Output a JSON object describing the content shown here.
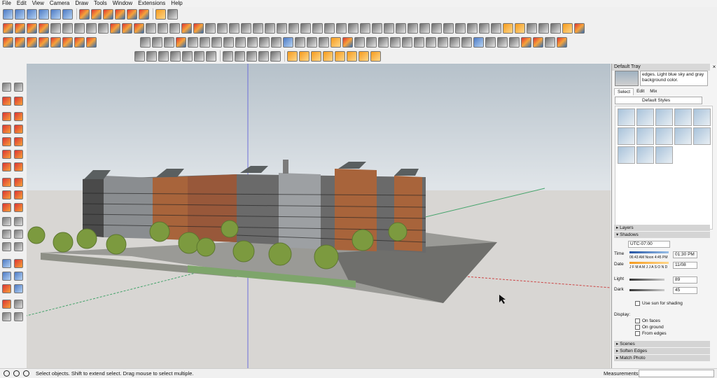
{
  "menu": [
    "File",
    "Edit",
    "View",
    "Camera",
    "Draw",
    "Tools",
    "Window",
    "Extensions",
    "Help"
  ],
  "tray": {
    "title": "Default Tray",
    "close": "×",
    "style_desc": "edges. Light blue sky and gray background color.",
    "tabs": [
      "Select",
      "Edit",
      "Mix"
    ],
    "style_dropdown": "Default Styles",
    "sections": {
      "layers": "▸ Layers",
      "shadows": "▾ Shadows",
      "scenes": "▸ Scenes",
      "soften": "▸ Soften Edges",
      "match": "▸ Match Photo"
    },
    "shadows": {
      "timezone": "UTC-07:00",
      "time_label": "Time",
      "time_ticks": "06:43 AM  Noon  4:45 PM",
      "time_value": "01:30 PM",
      "date_label": "Date",
      "months": "J F M A M J J A S O N D",
      "date_value": "11/08",
      "light_label": "Light",
      "light_value": "89",
      "dark_label": "Dark",
      "dark_value": "45",
      "use_sun": "Use sun for shading",
      "display_label": "Display:",
      "on_faces": "On faces",
      "on_ground": "On ground",
      "from_edges": "From edges"
    }
  },
  "status": {
    "message": "Select objects. Shift to extend select. Drag mouse to select multiple.",
    "measurements_label": "Measurements"
  }
}
